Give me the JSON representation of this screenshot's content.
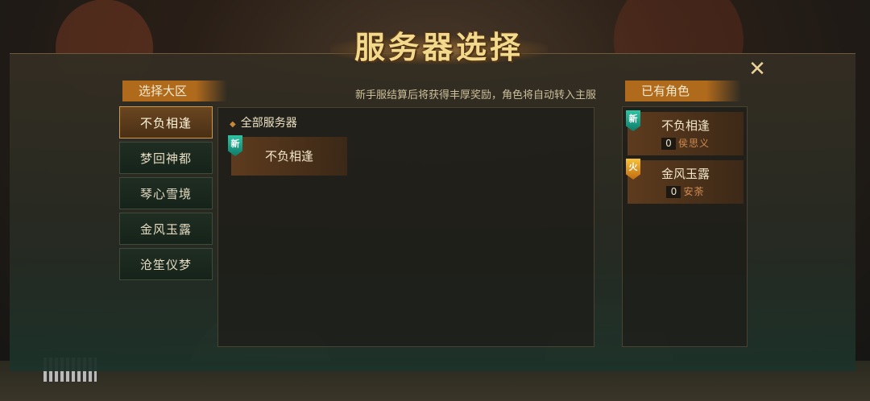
{
  "title": "服务器选择",
  "notice": "新手服结算后将获得丰厚奖励，角色将自动转入主服",
  "region_section": {
    "label": "选择大区"
  },
  "regions": [
    {
      "label": "不负相逢",
      "active": true
    },
    {
      "label": "梦回神都",
      "active": false
    },
    {
      "label": "琴心雪境",
      "active": false
    },
    {
      "label": "金风玉露",
      "active": false
    },
    {
      "label": "沧笙仪梦",
      "active": false
    }
  ],
  "server_list": {
    "header": "全部服务器",
    "servers": [
      {
        "name": "不负相逢",
        "tag": "新"
      }
    ]
  },
  "characters_section": {
    "label": "已有角色"
  },
  "characters": [
    {
      "server": "不负相逢",
      "level": "0",
      "name": "侯思义",
      "tag": "新"
    },
    {
      "server": "金风玉露",
      "level": "0",
      "name": "安荼",
      "tag": "火"
    }
  ],
  "icons": {
    "close": "close-x-icon",
    "bullet": "diamond-bullet-icon"
  },
  "colors": {
    "accent": "#b06a1c",
    "title": "#f3d98b",
    "tag_new": "#2ec5a3",
    "tag_hot": "#f7c23a"
  }
}
